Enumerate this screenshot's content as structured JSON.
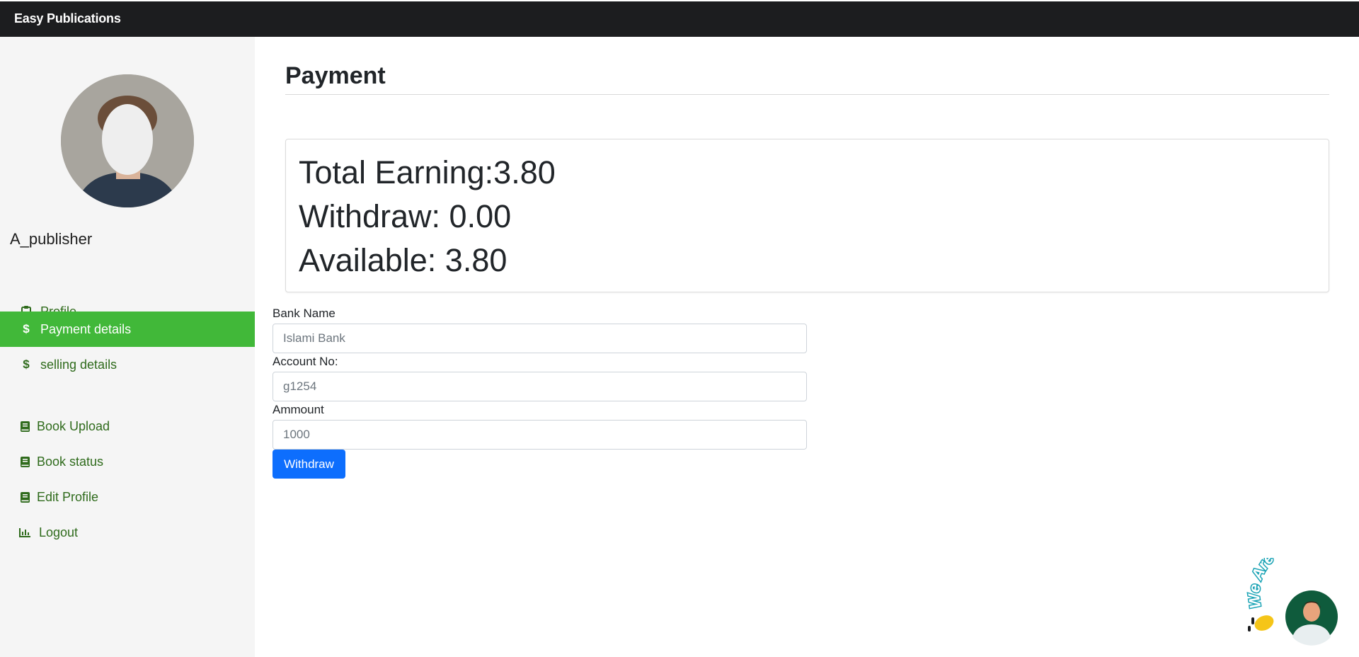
{
  "app": {
    "brand": "Easy Publications"
  },
  "sidebar": {
    "username": "A_publisher",
    "items": [
      {
        "label": "Profile",
        "icon": "clipboard-icon",
        "active": false
      },
      {
        "label": "Payment details",
        "icon": "dollar-icon",
        "active": true
      },
      {
        "label": "selling details",
        "icon": "dollar-icon",
        "active": false
      },
      {
        "label": "Book Upload",
        "icon": "book-icon",
        "active": false
      },
      {
        "label": "Book status",
        "icon": "book-icon",
        "active": false
      },
      {
        "label": "Edit Profile",
        "icon": "book-icon",
        "active": false
      },
      {
        "label": "Logout",
        "icon": "bar-chart-icon",
        "active": false
      }
    ]
  },
  "main": {
    "title": "Payment",
    "earnings": {
      "total": "Total Earning:3.80",
      "withdraw": "Withdraw: 0.00",
      "available": "Available: 3.80"
    },
    "form": {
      "bank_label": "Bank Name",
      "bank_placeholder": "Islami Bank",
      "account_label": "Account No:",
      "account_placeholder": "g1254",
      "amount_label": "Ammount",
      "amount_placeholder": "1000",
      "submit_label": "Withdraw"
    }
  },
  "chat_widget": {
    "text": "We Are Here!"
  },
  "colors": {
    "topbar": "#1c1d1f",
    "sidebar_bg": "#f5f5f5",
    "active_nav": "#41b839",
    "nav_text": "#2f6b1c",
    "primary_button": "#0d6efd"
  }
}
